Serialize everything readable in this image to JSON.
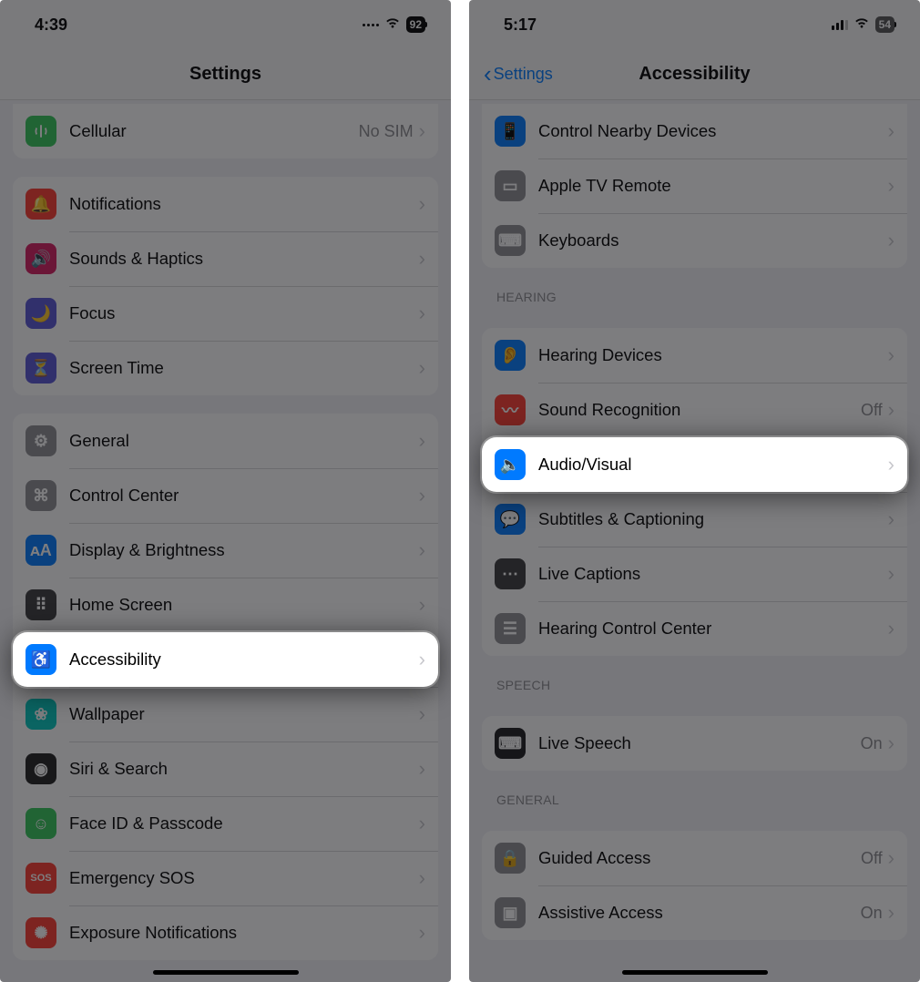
{
  "left": {
    "status": {
      "time": "4:39",
      "battery": "92"
    },
    "title": "Settings",
    "cellular": {
      "label": "Cellular",
      "detail": "No SIM",
      "iconColor": "#34c759",
      "glyph": "📶"
    },
    "section1": [
      {
        "label": "Notifications",
        "iconColor": "#ff3b30",
        "glyph": "🔔"
      },
      {
        "label": "Sounds & Haptics",
        "iconColor": "#d81b60",
        "glyph": "🔊"
      },
      {
        "label": "Focus",
        "iconColor": "#5856d6",
        "glyph": "🌙"
      },
      {
        "label": "Screen Time",
        "iconColor": "#5856d6",
        "glyph": "⏳"
      }
    ],
    "section2": [
      {
        "label": "General",
        "iconColor": "#8e8e93",
        "glyph": "⚙"
      },
      {
        "label": "Control Center",
        "iconColor": "#8e8e93",
        "glyph": "⌘"
      },
      {
        "label": "Display & Brightness",
        "iconColor": "#007aff",
        "glyph": "ᴀA"
      },
      {
        "label": "Home Screen",
        "iconColor": "#3a3a3c",
        "glyph": "⠿"
      },
      {
        "label": "Accessibility",
        "iconColor": "#007aff",
        "glyph": "♿",
        "hl": true
      },
      {
        "label": "Wallpaper",
        "iconColor": "#00c7be",
        "glyph": "❀"
      },
      {
        "label": "Siri & Search",
        "iconColor": "#1f1f1f",
        "glyph": "◉"
      },
      {
        "label": "Face ID & Passcode",
        "iconColor": "#34c759",
        "glyph": "☺"
      },
      {
        "label": "Emergency SOS",
        "iconColor": "#ff3b30",
        "glyph": "SOS"
      },
      {
        "label": "Exposure Notifications",
        "iconColor": "#ff3b30",
        "glyph": "✺"
      }
    ]
  },
  "right": {
    "status": {
      "time": "5:17",
      "battery": "54"
    },
    "back": "Settings",
    "title": "Accessibility",
    "sectionTop": [
      {
        "label": "Control Nearby Devices",
        "iconColor": "#007aff",
        "glyph": "📱"
      },
      {
        "label": "Apple TV Remote",
        "iconColor": "#8e8e93",
        "glyph": "▭"
      },
      {
        "label": "Keyboards",
        "iconColor": "#8e8e93",
        "glyph": "⌨"
      }
    ],
    "hearingHeader": "Hearing",
    "hearing": [
      {
        "label": "Hearing Devices",
        "iconColor": "#007aff",
        "glyph": "👂"
      },
      {
        "label": "Sound Recognition",
        "iconColor": "#ff3b30",
        "glyph": "〰",
        "detail": "Off"
      },
      {
        "label": "Audio/Visual",
        "iconColor": "#007aff",
        "glyph": "🔈",
        "hl": true
      },
      {
        "label": "Subtitles & Captioning",
        "iconColor": "#007aff",
        "glyph": "💬"
      },
      {
        "label": "Live Captions",
        "iconColor": "#3a3a3c",
        "glyph": "⋯"
      },
      {
        "label": "Hearing Control Center",
        "iconColor": "#8e8e93",
        "glyph": "☰"
      }
    ],
    "speechHeader": "Speech",
    "speech": [
      {
        "label": "Live Speech",
        "iconColor": "#1c1c1e",
        "glyph": "⌨",
        "detail": "On"
      }
    ],
    "generalHeader": "General",
    "general": [
      {
        "label": "Guided Access",
        "iconColor": "#8e8e93",
        "glyph": "🔒",
        "detail": "Off"
      },
      {
        "label": "Assistive Access",
        "iconColor": "#8e8e93",
        "glyph": "▣",
        "detail": "On"
      }
    ]
  }
}
